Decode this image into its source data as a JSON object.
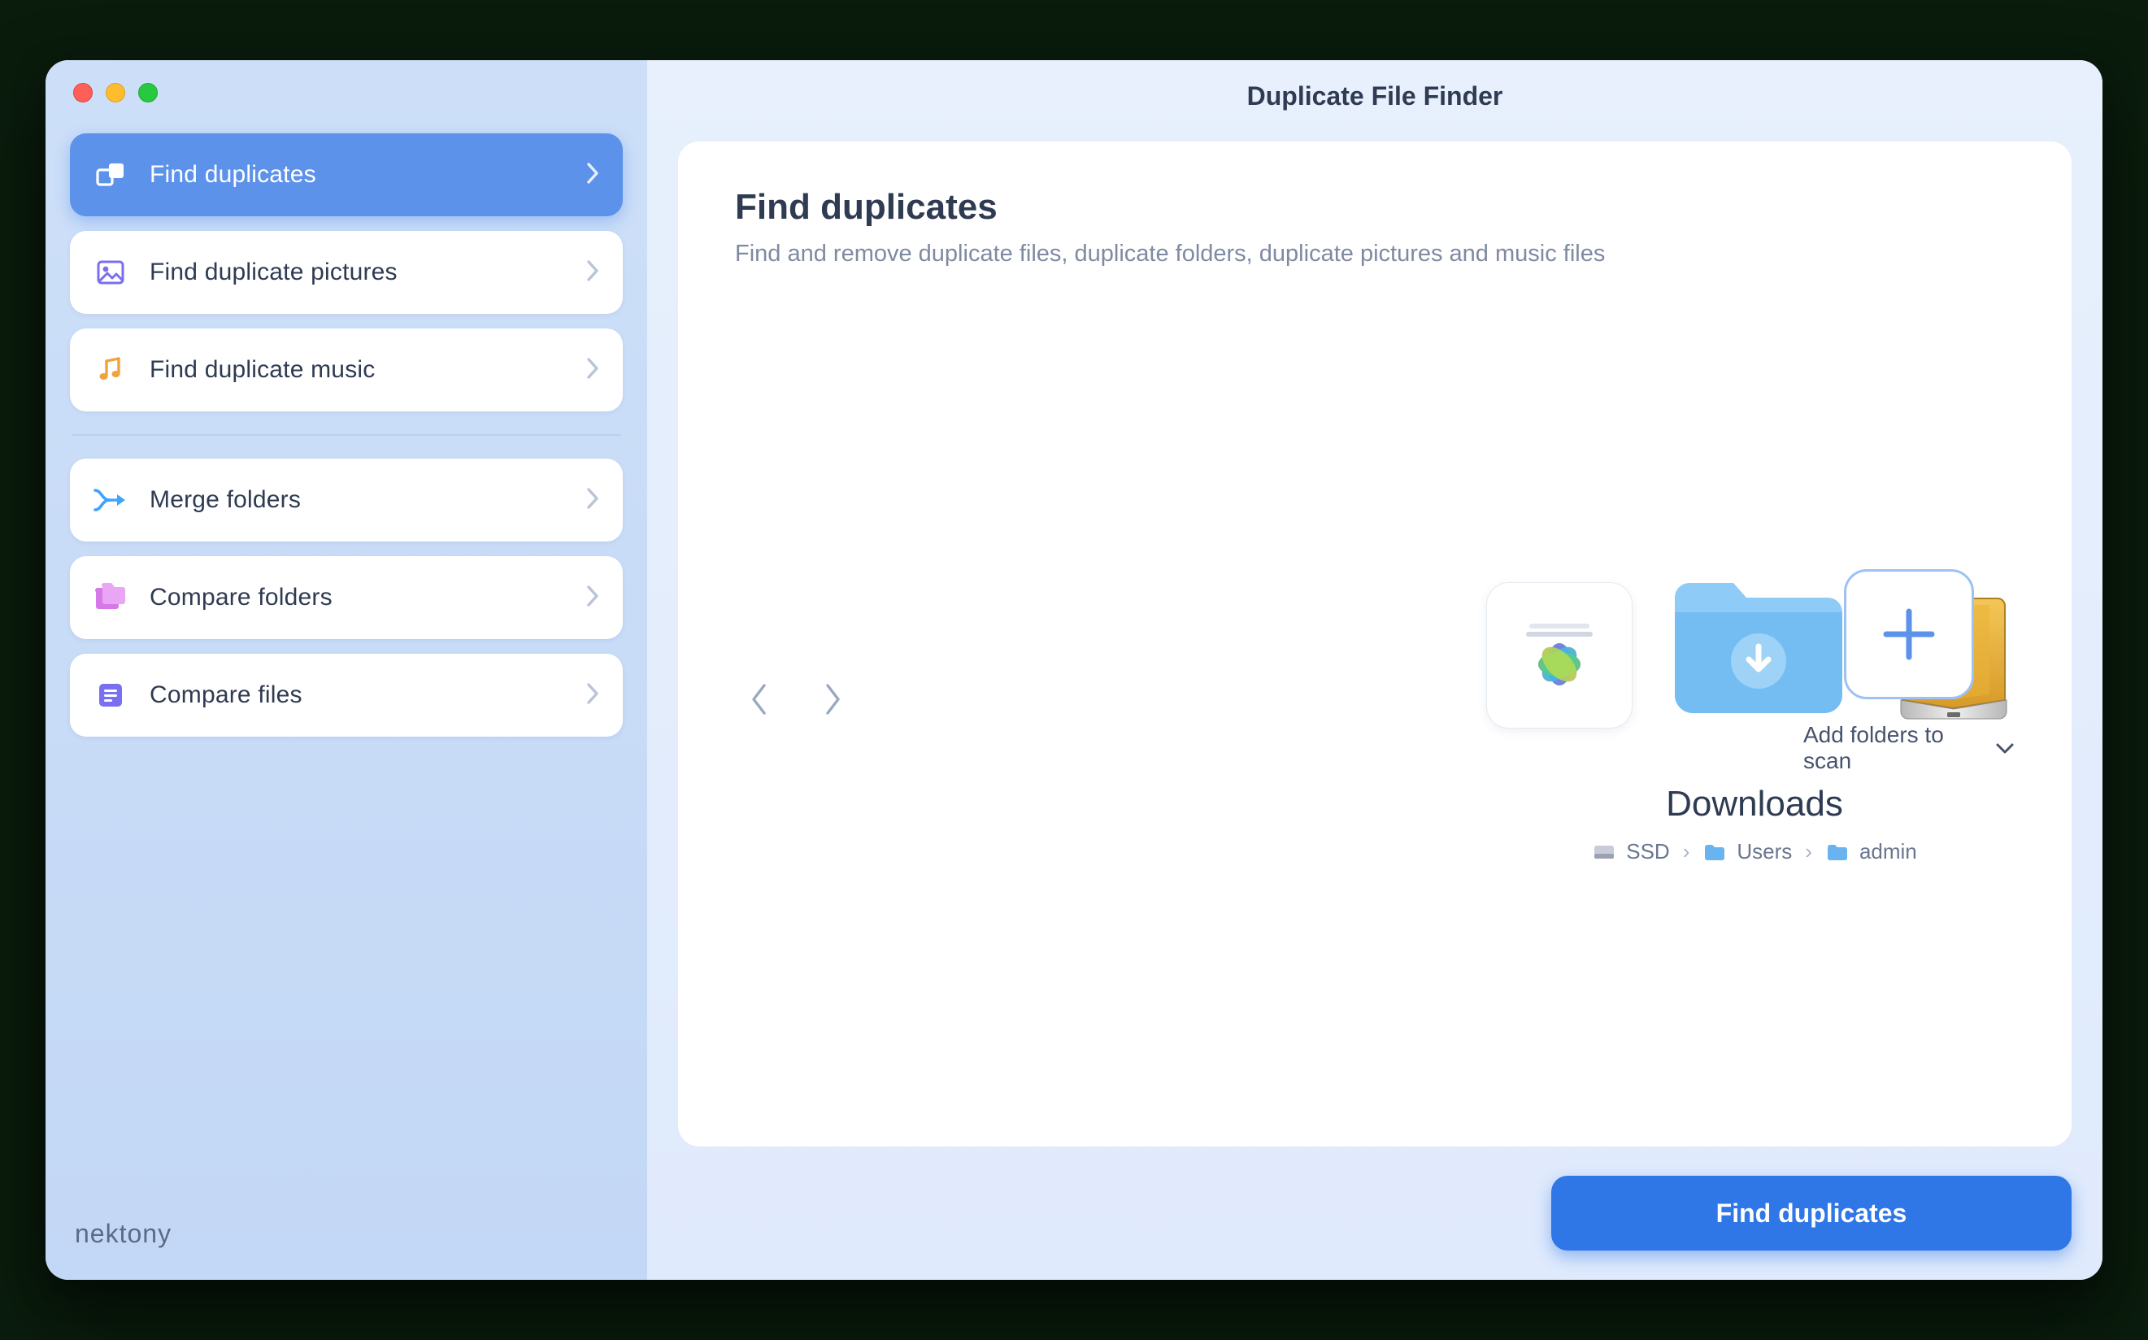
{
  "window": {
    "title": "Duplicate File Finder"
  },
  "sidebar": {
    "items": [
      {
        "label": "Find duplicates",
        "icon": "duplicates-icon",
        "active": true
      },
      {
        "label": "Find duplicate pictures",
        "icon": "picture-icon",
        "active": false
      },
      {
        "label": "Find duplicate music",
        "icon": "music-icon",
        "active": false
      },
      {
        "label": "Merge folders",
        "icon": "merge-icon",
        "active": false
      },
      {
        "label": "Compare folders",
        "icon": "compare-folders-icon",
        "active": false
      },
      {
        "label": "Compare files",
        "icon": "compare-files-icon",
        "active": false
      }
    ],
    "brand": "nektony"
  },
  "main": {
    "heading": "Find duplicates",
    "subheading": "Find and remove duplicate files, duplicate folders, duplicate pictures and music files",
    "selected_location": {
      "name": "Downloads",
      "path": [
        "SSD",
        "Users",
        "admin"
      ]
    },
    "add_label": "Add folders to scan",
    "primary_button": "Find duplicates"
  },
  "colors": {
    "accent": "#5d92ea",
    "primary_button": "#2f76e6",
    "text": "#2f3b52",
    "muted": "#7f8aa1"
  }
}
